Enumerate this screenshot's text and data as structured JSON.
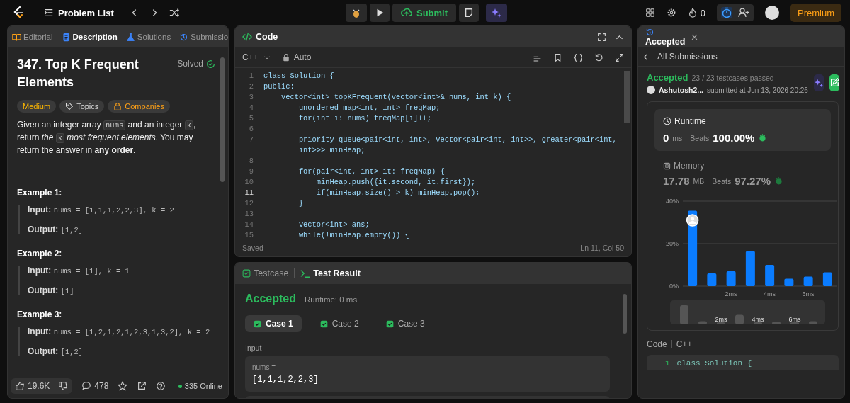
{
  "topbar": {
    "title": "Problem List",
    "submit": "Submit",
    "streak": "0",
    "premium": "Premium"
  },
  "left": {
    "tabs": [
      {
        "label": "Editorial",
        "selected": false
      },
      {
        "label": "Description",
        "selected": true
      },
      {
        "label": "Solutions",
        "selected": false
      },
      {
        "label": "Submissio",
        "selected": false
      }
    ],
    "title": "347. Top K Frequent Elements",
    "status": "Solved",
    "tags": [
      {
        "label": "Medium",
        "kind": "difficulty"
      },
      {
        "label": "Topics",
        "kind": "topics"
      },
      {
        "label": "Companies",
        "kind": "companies"
      }
    ],
    "description": [
      {
        "kind": "text",
        "text": "Given an integer array "
      },
      {
        "kind": "code",
        "text": "nums"
      },
      {
        "kind": "text",
        "text": " and an integer "
      },
      {
        "kind": "code",
        "text": "k"
      },
      {
        "kind": "text",
        "text": ", return "
      },
      {
        "kind": "italic",
        "text": "the "
      },
      {
        "kind": "code",
        "text": "k"
      },
      {
        "kind": "italic",
        "text": " most frequent elements"
      },
      {
        "kind": "text",
        "text": ". You may return the answer in "
      },
      {
        "kind": "bold",
        "text": "any order"
      },
      {
        "kind": "text",
        "text": "."
      }
    ],
    "examples": [
      {
        "title": "Example 1:",
        "input_label": "Input:",
        "input": "nums = [1,1,1,2,2,3], k = 2",
        "output_label": "Output:",
        "output": "[1,2]"
      },
      {
        "title": "Example 2:",
        "input_label": "Input:",
        "input": "nums = [1], k = 1",
        "output_label": "Output:",
        "output": "[1]"
      },
      {
        "title": "Example 3:",
        "input_label": "Input:",
        "input": "nums = [1,2,1,2,1,2,3,1,3,2], k = 2",
        "output_label": "Output:",
        "output": "[1,2]"
      }
    ],
    "footer": {
      "likes": "19.6K",
      "comments": "478",
      "online": "335 Online"
    }
  },
  "code": {
    "title": "Code",
    "language": "C++",
    "mode": "Auto",
    "lines": [
      {
        "number": "1",
        "text": "class Solution {",
        "active": false
      },
      {
        "number": "2",
        "text": "public:",
        "active": false
      },
      {
        "number": "3",
        "text": "    vector<int> topKFrequent(vector<int>& nums, int k) {",
        "active": false
      },
      {
        "number": "4",
        "text": "        unordered_map<int, int> freqMap;",
        "active": false
      },
      {
        "number": "5",
        "text": "        for(int i: nums) freqMap[i]++;",
        "active": false
      },
      {
        "number": "6",
        "active": false
      },
      {
        "number": "7",
        "text": "        priority_queue<pair<int, int>, vector<pair<int, int>>, greater<pair<int,",
        "continuation": "        int>>> minHeap;",
        "active": false
      },
      {
        "number": "8",
        "active": false
      },
      {
        "number": "9",
        "text": "        for(pair<int, int> it: freqMap) {",
        "active": false
      },
      {
        "number": "10",
        "text": "            minHeap.push({it.second, it.first});",
        "active": false
      },
      {
        "number": "11",
        "text": "            if(minHeap.size() > k) minHeap.pop();",
        "active": true
      },
      {
        "number": "12",
        "text": "        }",
        "active": false
      },
      {
        "number": "13",
        "active": false
      },
      {
        "number": "14",
        "text": "        vector<int> ans;",
        "active": false
      },
      {
        "number": "15",
        "text": "        while(!minHeap.empty()) {",
        "active": false
      }
    ],
    "saved": "Saved",
    "position": "Ln 11, Col 50"
  },
  "result": {
    "tabs": [
      {
        "label": "Testcase",
        "selected": false
      },
      {
        "label": "Test Result",
        "selected": true
      }
    ],
    "verdict": "Accepted",
    "runtime": "Runtime: 0 ms",
    "cases": [
      {
        "label": "Case 1",
        "selected": true
      },
      {
        "label": "Case 2",
        "selected": false
      },
      {
        "label": "Case 3",
        "selected": false
      }
    ],
    "input_title": "Input",
    "param": "nums =",
    "value": "[1,1,1,2,2,3]"
  },
  "submission": {
    "tab": "Accepted",
    "back": "All Submissions",
    "verdict": "Accepted",
    "passed": "23 / 23 testcases passed",
    "user": "Ashutosh2...",
    "submitted": "submitted at Jun 13, 2026 20:26",
    "runtime": {
      "title": "Runtime",
      "value": "0",
      "unit": "ms",
      "beats_label": "Beats",
      "beats": "100.00%"
    },
    "memory": {
      "title": "Memory",
      "value": "17.78",
      "unit": "MB",
      "beats_label": "Beats",
      "beats": "97.27%"
    },
    "chart_data": {
      "type": "bar",
      "x": [
        0,
        1,
        2,
        3,
        4,
        5,
        6,
        7
      ],
      "series": [
        {
          "color": "#0a7cff",
          "values": [
            35.5,
            6,
            7,
            16.5,
            10,
            3.5,
            4.5,
            6.5
          ]
        }
      ],
      "xlim": [
        -0.5,
        7.5
      ],
      "ylim": [
        0,
        40
      ],
      "yticks": [
        {
          "value": 0,
          "label": "0%"
        },
        {
          "value": 20,
          "label": "20%"
        },
        {
          "value": 40,
          "label": "40%"
        }
      ],
      "xticks": [
        {
          "value": 2,
          "label": "2ms"
        },
        {
          "value": 4,
          "label": "4ms"
        },
        {
          "value": 6,
          "label": "6ms"
        }
      ]
    },
    "overview_labels": [
      "2ms",
      "4ms",
      "6ms"
    ],
    "code_label": "Code",
    "code_language": "C++",
    "code_line_number": "1",
    "code_line": "class Solution {"
  }
}
